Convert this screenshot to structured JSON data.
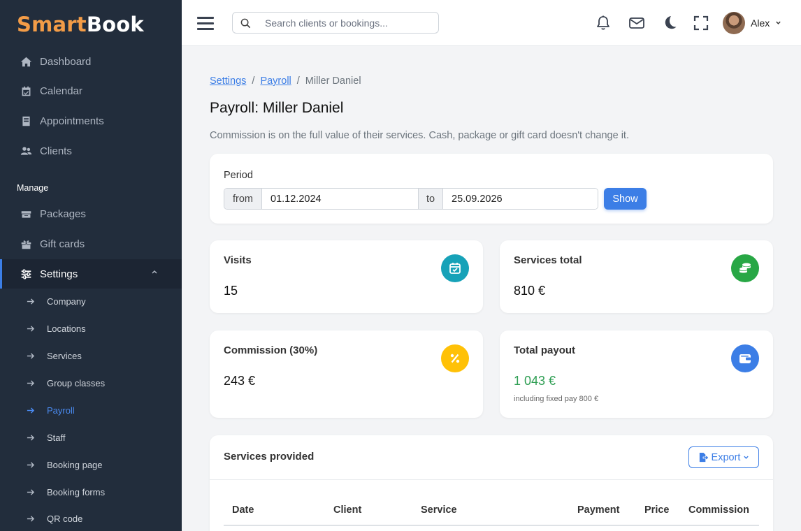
{
  "app": {
    "logo_part1": "Smart",
    "logo_part2": "Book"
  },
  "sidebar": {
    "items": [
      {
        "label": "Dashboard",
        "icon": "home-icon"
      },
      {
        "label": "Calendar",
        "icon": "calendar-icon"
      },
      {
        "label": "Appointments",
        "icon": "book-icon"
      },
      {
        "label": "Clients",
        "icon": "users-icon"
      }
    ],
    "section_label": "Manage",
    "manage_items": [
      {
        "label": "Packages",
        "icon": "package-icon"
      },
      {
        "label": "Gift cards",
        "icon": "gift-icon"
      },
      {
        "label": "Settings",
        "icon": "sliders-icon",
        "active": true
      }
    ],
    "settings_subitems": [
      {
        "label": "Company"
      },
      {
        "label": "Locations"
      },
      {
        "label": "Services"
      },
      {
        "label": "Group classes"
      },
      {
        "label": "Payroll",
        "active": true
      },
      {
        "label": "Staff"
      },
      {
        "label": "Booking page"
      },
      {
        "label": "Booking forms"
      },
      {
        "label": "QR code"
      }
    ]
  },
  "topbar": {
    "search_placeholder": "Search clients or bookings...",
    "user_name": "Alex"
  },
  "breadcrumb": {
    "item1": "Settings",
    "item2": "Payroll",
    "current": "Miller Daniel",
    "separator": "/"
  },
  "page": {
    "title": "Payroll: Miller Daniel",
    "description": "Commission is on the full value of their services. Cash, package or gift card doesn't change it."
  },
  "period": {
    "label": "Period",
    "from_label": "from",
    "from_value": "01.12.2024",
    "to_label": "to",
    "to_value": "25.09.2026",
    "show_button": "Show"
  },
  "stats": {
    "visits": {
      "label": "Visits",
      "value": "15",
      "icon": "calendar-check-icon",
      "color": "#17a2b8"
    },
    "services_total": {
      "label": "Services total",
      "value": "810 €",
      "icon": "coins-icon",
      "color": "#28a745"
    },
    "commission": {
      "label": "Commission (30%)",
      "value": "243 €",
      "icon": "percent-icon",
      "color": "#ffc107"
    },
    "total_payout": {
      "label": "Total payout",
      "value": "1 043 €",
      "sub": "including fixed pay 800 €",
      "icon": "wallet-icon",
      "color": "#3c7ee6"
    }
  },
  "services": {
    "title": "Services provided",
    "export_label": "Export",
    "columns": [
      "Date",
      "Client",
      "Service",
      "Payment",
      "Price",
      "Commission"
    ]
  },
  "colors": {
    "accent": "#3c7ee6",
    "sidebar_bg": "#222d3c",
    "logo_orange": "#f39c47",
    "success": "#2e9e53"
  }
}
